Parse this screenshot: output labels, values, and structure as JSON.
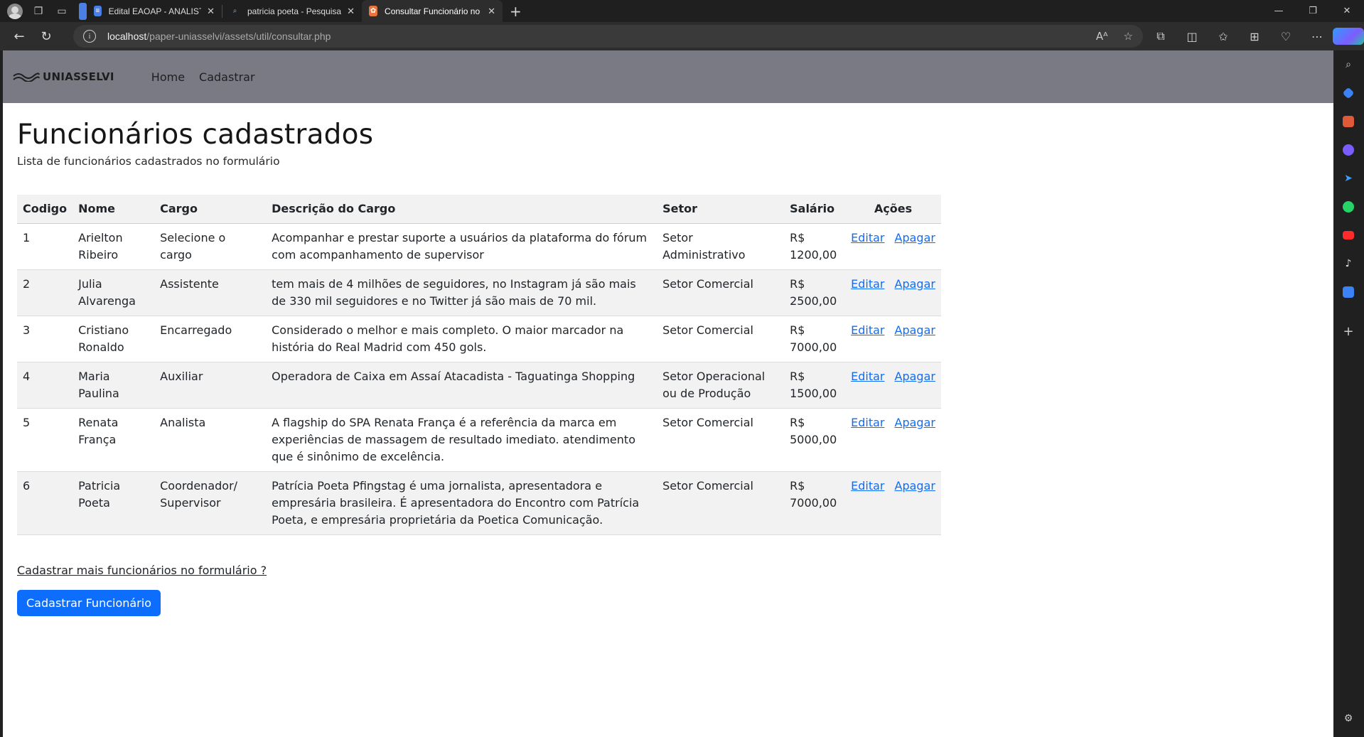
{
  "browser": {
    "tabs": [
      {
        "title": "Edital EAOAP - ANALISTA DE SIS",
        "color": "#4a7fe6",
        "active": false
      },
      {
        "title": "patricia poeta - Pesquisar",
        "color": "#3b82f6",
        "active": false
      },
      {
        "title": "Consultar Funcionário no formul",
        "color": "#e8743b",
        "active": true
      }
    ],
    "url_host": "localhost",
    "url_path": "/paper-uniasselvi/assets/util/consultar.php"
  },
  "navbar": {
    "brand": "UNIASSELVI",
    "links": [
      "Home",
      "Cadastrar"
    ]
  },
  "page": {
    "title": "Funcionários cadastrados",
    "subtitle": "Lista de funcionários cadastrados no formulário",
    "more_link": "Cadastrar mais funcionários no formulário ?",
    "button": "Cadastrar Funcionário"
  },
  "table": {
    "headers": [
      "Codigo",
      "Nome",
      "Cargo",
      "Descrição do Cargo",
      "Setor",
      "Salário",
      "Ações"
    ],
    "edit_label": "Editar",
    "delete_label": "Apagar",
    "rows": [
      {
        "codigo": "1",
        "nome": "Arielton Ribeiro",
        "cargo": "Selecione o cargo",
        "descricao": "Acompanhar e prestar suporte a usuários da plataforma do fórum com acompanhamento de supervisor",
        "setor": "Setor Administrativo",
        "salario": "R$ 1200,00"
      },
      {
        "codigo": "2",
        "nome": "Julia Alvarenga",
        "cargo": "Assistente",
        "descricao": "tem mais de 4 milhões de seguidores, no Instagram já são mais de 330 mil seguidores e no Twitter já são mais de 70 mil.",
        "setor": "Setor Comercial",
        "salario": "R$ 2500,00"
      },
      {
        "codigo": "3",
        "nome": "Cristiano Ronaldo",
        "cargo": "Encarregado",
        "descricao": "Considerado o melhor e mais completo. O maior marcador na história do Real Madrid com 450 gols.",
        "setor": "Setor Comercial",
        "salario": "R$ 7000,00"
      },
      {
        "codigo": "4",
        "nome": "Maria Paulina",
        "cargo": "Auxiliar",
        "descricao": "Operadora de Caixa em Assaí Atacadista - Taguatinga Shopping",
        "setor": "Setor Operacional ou de Produção",
        "salario": "R$ 1500,00"
      },
      {
        "codigo": "5",
        "nome": "Renata França",
        "cargo": "Analista",
        "descricao": "A flagship do SPA Renata França é a referência da marca em experiências de massagem de resultado imediato. atendimento que é sinônimo de excelência.",
        "setor": "Setor Comercial",
        "salario": "R$ 5000,00"
      },
      {
        "codigo": "6",
        "nome": "Patricia Poeta",
        "cargo": "Coordenador/ Supervisor",
        "descricao": "Patrícia Poeta Pfingstag é uma jornalista, apresentadora e empresária brasileira. É apresentadora do Encontro com Patrícia Poeta, e empresária proprietária da Poetica Comunicação.",
        "setor": "Setor Comercial",
        "salario": "R$ 7000,00"
      }
    ]
  },
  "colors": {
    "navbar_bg": "#7a7a85",
    "link": "#0d6efd",
    "button_bg": "#0d6efd"
  }
}
